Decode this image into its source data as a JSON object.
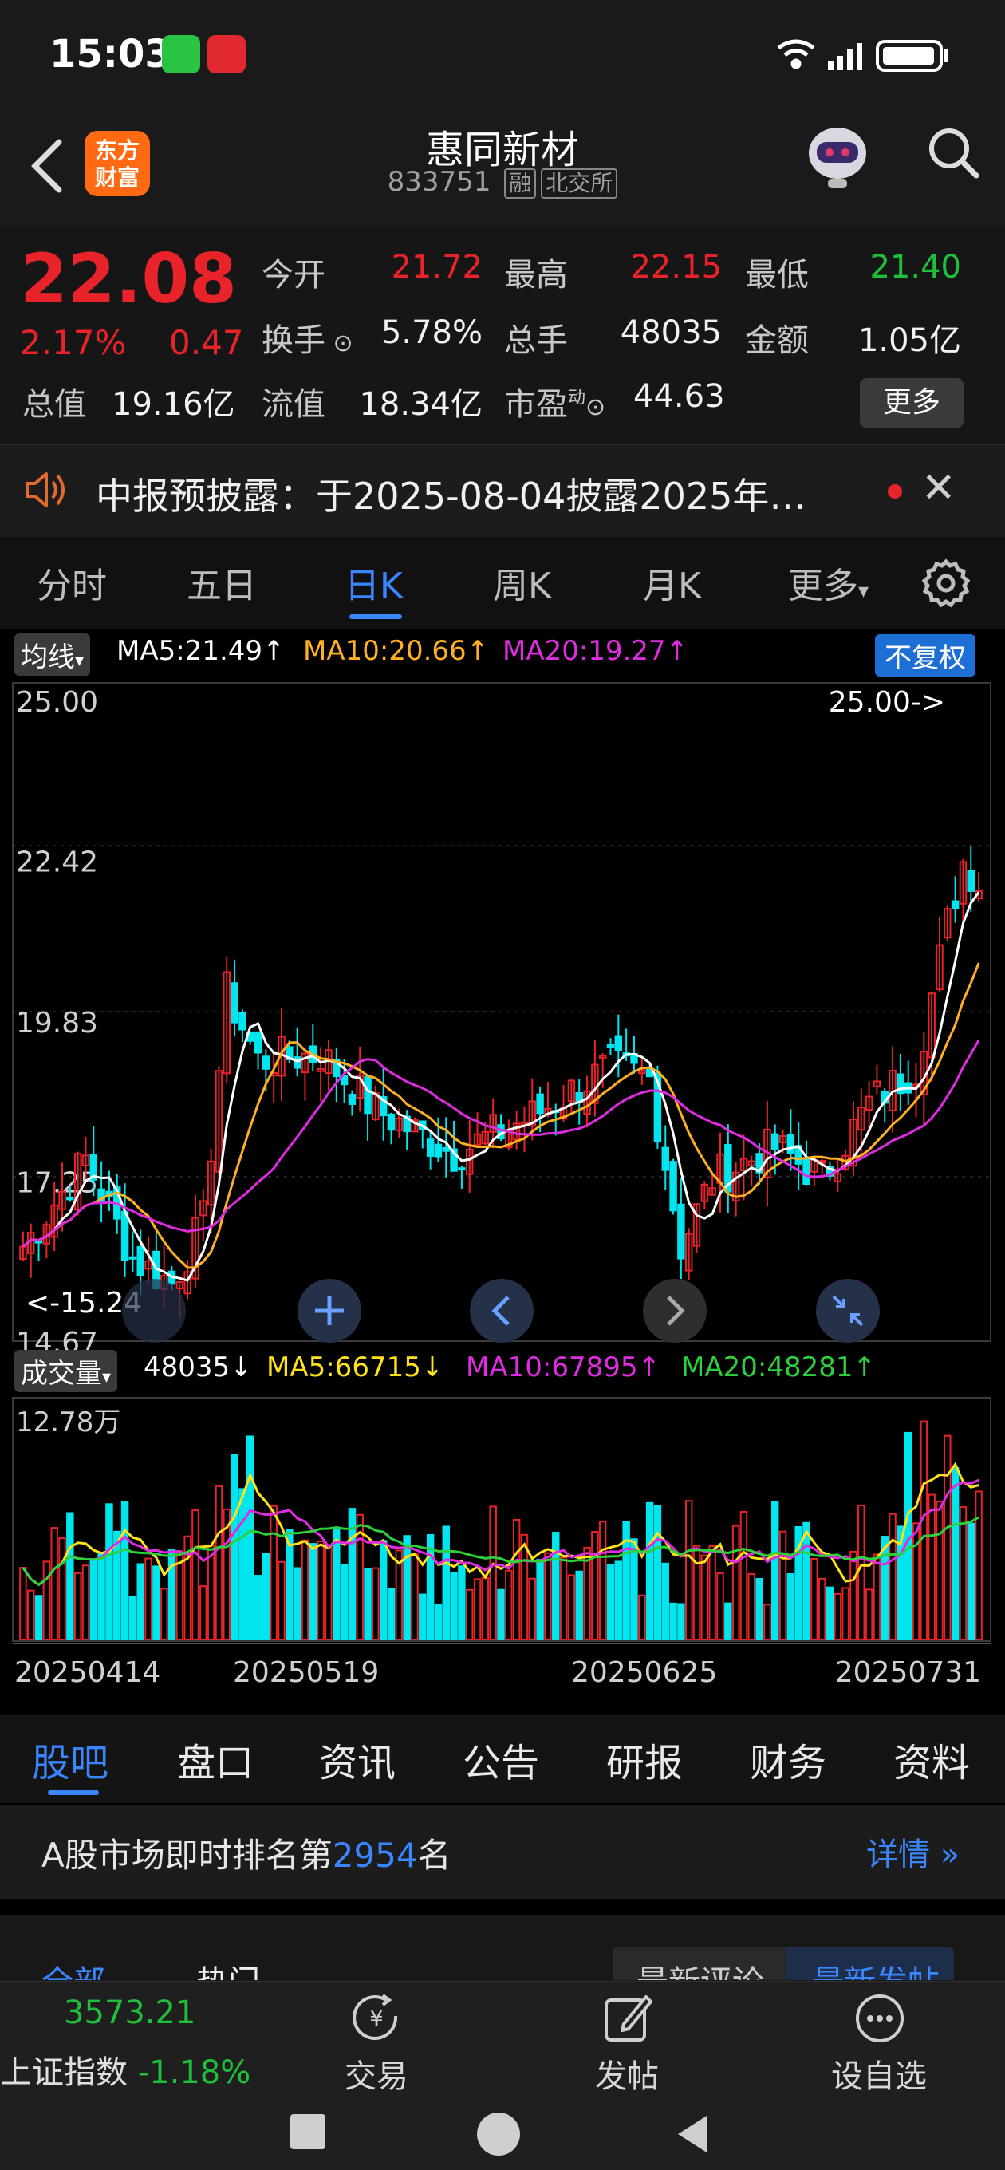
{
  "status_bar": {
    "time": "15:03"
  },
  "header": {
    "logo_line1": "东方",
    "logo_line2": "财富",
    "stock_name": "惠同新材",
    "stock_code": "833751",
    "tag_margin": "融",
    "tag_exchange": "北交所"
  },
  "quote": {
    "price": "22.08",
    "change_pct": "2.17%",
    "change_amt": "0.47",
    "open_label": "今开",
    "open_value": "21.72",
    "high_label": "最高",
    "high_value": "22.15",
    "low_label": "最低",
    "low_value": "21.40",
    "turnover_label": "换手",
    "turnover_value": "5.78%",
    "volume_label": "总手",
    "volume_value": "48035",
    "amount_label": "金额",
    "amount_value": "1.05亿",
    "mktcap_label": "总值",
    "mktcap_value": "19.16亿",
    "float_label": "流值",
    "float_value": "18.34亿",
    "pe_label": "市盈",
    "pe_sup": "动",
    "pe_value": "44.63",
    "more_label": "更多"
  },
  "notice": {
    "text": "中报预披露：于2025-08-04披露2025年…"
  },
  "period_tabs": [
    "分时",
    "五日",
    "日K",
    "周K",
    "月K",
    "更多"
  ],
  "kline": {
    "indicator_label": "均线",
    "ma5": "MA5:21.49↑",
    "ma10": "MA10:20.66↑",
    "ma20": "MA20:19.27↑",
    "adjust_label": "不复权",
    "max_marker": "25.00->",
    "min_marker": "<-15.24",
    "y_ticks": [
      "25.00",
      "22.42",
      "19.83",
      "17.25",
      "14.67"
    ]
  },
  "volume": {
    "indicator_label": "成交量",
    "current": "48035↓",
    "ma5": "MA5:66715↓",
    "ma10": "MA10:67895↑",
    "ma20": "MA20:48281↑",
    "y_top": "12.78万",
    "x_labels": [
      "20250414",
      "20250519",
      "20250625",
      "20250731"
    ]
  },
  "section_tabs": [
    "股吧",
    "盘口",
    "资讯",
    "公告",
    "研报",
    "财务",
    "资料"
  ],
  "rank": {
    "prefix": "A股市场即时排名第",
    "number": "2954",
    "suffix": "名",
    "detail": "详情"
  },
  "sub_tabs": {
    "left1": "全部",
    "left2": "热门",
    "right1": "最新评论",
    "right2": "最新发帖"
  },
  "bottom_nav": {
    "index_value": "3573.21",
    "index_name": "上证指数",
    "index_change": "-1.18%",
    "trade": "交易",
    "post": "发帖",
    "watchlist": "设自选"
  },
  "colors": {
    "up": "#e8232a",
    "down": "#00e5ee",
    "accent": "#3a86ff"
  },
  "chart_data": {
    "type": "candlestick",
    "y_range": [
      14.67,
      25.0
    ],
    "x_labels": [
      "20250414",
      "20250519",
      "20250625",
      "20250731"
    ],
    "last_close": 22.08,
    "period_high": 25.0,
    "period_low": 15.24,
    "volume_top": "12.78万"
  }
}
